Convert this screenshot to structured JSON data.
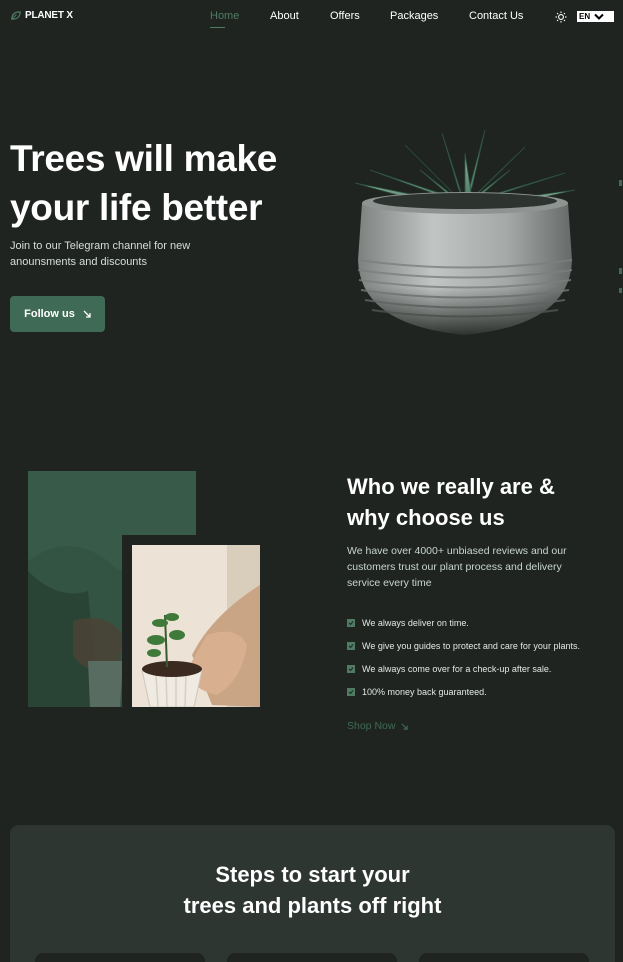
{
  "brand": {
    "name": "PLANET X"
  },
  "nav": {
    "links": [
      {
        "label": "Home",
        "active": true
      },
      {
        "label": "About"
      },
      {
        "label": "Offers"
      },
      {
        "label": "Packages"
      },
      {
        "label": "Contact Us"
      }
    ],
    "language": "EN",
    "icons": {
      "theme": "sun-icon",
      "language": "chevron-down-icon"
    }
  },
  "hero": {
    "title_line1": "Trees will make",
    "title_line2": "your life better",
    "subtitle": "Join to our Telegram channel for new anounsments and discounts",
    "button_label": "Follow us"
  },
  "about": {
    "title_line1": "Who we really are &",
    "title_line2": "why choose us",
    "text": "We have over 4000+ unbiased reviews and our customers trust our plant process and delivery service every time",
    "checklist": [
      "We always deliver on time.",
      "We give you guides to protect and care for your plants.",
      "We always come over for a check-up after sale.",
      "100% money back guaranteed."
    ],
    "shop_link": "Shop Now"
  },
  "steps": {
    "title_line1": "Steps to start your",
    "title_line2": "trees and plants off right"
  },
  "colors": {
    "background": "#1f2421",
    "accent": "#3f6a55",
    "accent_light": "#4f7b63",
    "panel": "#2e3632"
  }
}
